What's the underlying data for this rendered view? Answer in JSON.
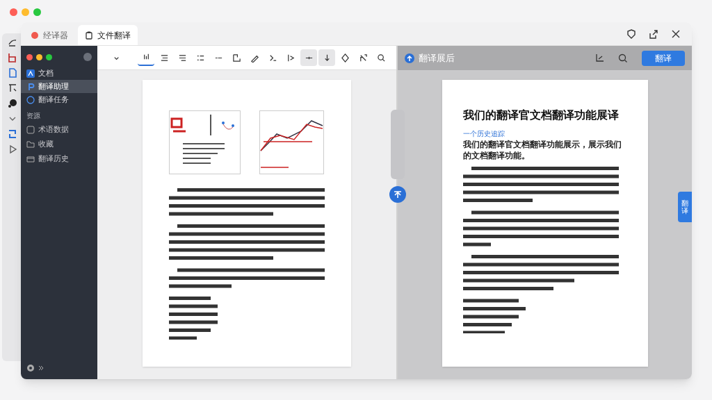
{
  "window": {
    "tabs": [
      {
        "label": "经译器",
        "selected": false,
        "kind": "dot"
      },
      {
        "label": "文件翻译",
        "selected": true,
        "kind": "doc"
      }
    ]
  },
  "sidebar": {
    "items": [
      {
        "label": "文档",
        "selected": false,
        "kind": "app"
      },
      {
        "label": "翻译助理",
        "selected": true,
        "kind": "pin"
      },
      {
        "label": "翻译任务",
        "selected": false,
        "kind": "ring"
      }
    ],
    "section": "资源",
    "section_items": [
      {
        "label": "术语数据",
        "kind": "box"
      },
      {
        "label": "收藏",
        "kind": "folder"
      },
      {
        "label": "翻译历史",
        "kind": "tray"
      }
    ]
  },
  "toolbar": {
    "tools": [
      {
        "selected": false
      },
      {
        "selected": true
      },
      {
        "selected": false
      },
      {
        "selected": false
      },
      {
        "selected": false
      },
      {
        "selected": false
      },
      {
        "selected": false
      },
      {
        "selected": false
      },
      {
        "selected": false
      },
      {
        "selected": false
      },
      {
        "selected": true
      },
      {
        "selected": true
      },
      {
        "selected": false
      },
      {
        "selected": false
      },
      {
        "selected": false
      }
    ]
  },
  "translated_pane": {
    "title": "翻译展后",
    "button": "翻译",
    "side_tab": "翻译",
    "document": {
      "title": "我们的翻译官文档翻译功能展译",
      "kicker": "一个历史追踪",
      "subtitle": "我们的翻译官文档翻译功能展示，展示我们的文档翻译功能。"
    }
  }
}
